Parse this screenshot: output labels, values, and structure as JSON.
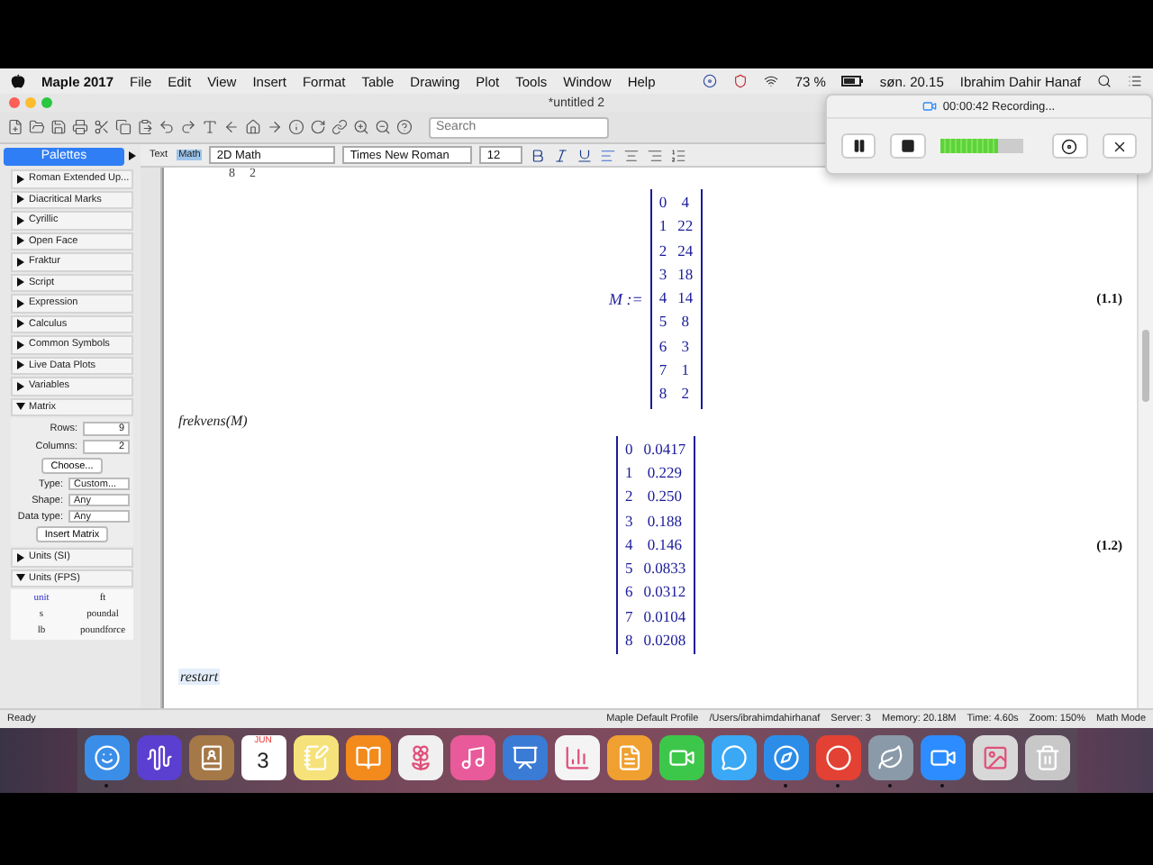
{
  "menu_bar": {
    "app": "Maple 2017",
    "items": [
      "File",
      "Edit",
      "View",
      "Insert",
      "Format",
      "Table",
      "Drawing",
      "Plot",
      "Tools",
      "Window",
      "Help"
    ],
    "battery": "73 %",
    "clock": "søn. 20.15",
    "user": "Ibrahim Dahir Hanaf"
  },
  "window": {
    "title": "*untitled 2"
  },
  "toolbar": {
    "search": {
      "placeholder": "Search"
    }
  },
  "context_bar": {
    "modes": [
      {
        "label": "Text",
        "selected": false
      },
      {
        "label": "Math",
        "selected": true
      }
    ],
    "style": "2D Math",
    "font": "Times New Roman",
    "size": "12"
  },
  "palettes": {
    "title": "Palettes",
    "sections": [
      {
        "label": "Roman Extended Up...",
        "expanded": false
      },
      {
        "label": "Diacritical Marks",
        "expanded": false
      },
      {
        "label": "Cyrillic",
        "expanded": false
      },
      {
        "label": "Open Face",
        "expanded": false
      },
      {
        "label": "Fraktur",
        "expanded": false
      },
      {
        "label": "Script",
        "expanded": false
      },
      {
        "label": "Expression",
        "expanded": false
      },
      {
        "label": "Calculus",
        "expanded": false
      },
      {
        "label": "Common Symbols",
        "expanded": false
      },
      {
        "label": "Live Data Plots",
        "expanded": false
      },
      {
        "label": "Variables",
        "expanded": false
      },
      {
        "label": "Matrix",
        "expanded": true,
        "kind": "matrix",
        "rows_label": "Rows:",
        "rows": "9",
        "columns_label": "Columns:",
        "columns": "2",
        "choose": "Choose...",
        "type_label": "Type:",
        "type": "Custom...",
        "shape_label": "Shape:",
        "shape": "Any",
        "data_type_label": "Data type:",
        "data_type": "Any",
        "insert": "Insert Matrix"
      },
      {
        "label": "Units (SI)",
        "expanded": false
      },
      {
        "label": "Units (FPS)",
        "expanded": true,
        "kind": "units",
        "units": [
          {
            "label": "unit",
            "selected": true
          },
          {
            "label": "ft",
            "selected": false
          },
          {
            "label": "s",
            "selected": false
          },
          {
            "label": "poundal",
            "selected": false
          },
          {
            "label": "lb",
            "selected": false
          },
          {
            "label": "poundforce",
            "selected": false
          }
        ]
      }
    ]
  },
  "document": {
    "previous_row": [
      "8",
      "2"
    ],
    "outputs": [
      {
        "lhs": "M",
        "assign": ":=",
        "rows": [
          [
            "0",
            "4"
          ],
          [
            "1",
            "22"
          ],
          [
            "2",
            "24"
          ],
          [
            "3",
            "18"
          ],
          [
            "4",
            "14"
          ],
          [
            "5",
            "8"
          ],
          [
            "6",
            "3"
          ],
          [
            "7",
            "1"
          ],
          [
            "8",
            "2"
          ]
        ],
        "label": "(1.1)"
      },
      {
        "input": "frekvens(M)",
        "rows": [
          [
            "0",
            "0.0417"
          ],
          [
            "1",
            "0.229"
          ],
          [
            "2",
            "0.250"
          ],
          [
            "3",
            "0.188"
          ],
          [
            "4",
            "0.146"
          ],
          [
            "5",
            "0.0833"
          ],
          [
            "6",
            "0.0312"
          ],
          [
            "7",
            "0.0104"
          ],
          [
            "8",
            "0.0208"
          ]
        ],
        "label": "(1.2)"
      }
    ],
    "next_input": "restart"
  },
  "status_bar": {
    "left": "Ready",
    "items": [
      "Maple Default Profile",
      "/Users/ibrahimdahirhanaf",
      "Server: 3",
      "Memory: 20.18M",
      "Time: 4.60s",
      "Zoom: 150%",
      "Math Mode"
    ]
  },
  "recording": {
    "title": "00:00:42 Recording...",
    "level": 0.7
  },
  "dock": [
    {
      "kind": "finder",
      "running": true
    },
    {
      "kind": "siri",
      "running": false
    },
    {
      "kind": "contacts",
      "running": false
    },
    {
      "kind": "calendar",
      "running": false,
      "month": "JUN",
      "day": "3"
    },
    {
      "kind": "notes",
      "running": false
    },
    {
      "kind": "books",
      "running": false
    },
    {
      "kind": "photos",
      "running": false
    },
    {
      "kind": "music",
      "running": false
    },
    {
      "kind": "keynote",
      "running": false
    },
    {
      "kind": "numbers",
      "running": false
    },
    {
      "kind": "pages",
      "running": false
    },
    {
      "kind": "facetime",
      "running": false
    },
    {
      "kind": "messages",
      "running": false
    },
    {
      "kind": "safari",
      "running": true
    },
    {
      "kind": "chrome",
      "running": true
    },
    {
      "kind": "maple",
      "running": true
    },
    {
      "kind": "zoom",
      "running": true
    },
    {
      "kind": "preview",
      "running": false
    },
    {
      "kind": "trash",
      "running": false
    }
  ]
}
